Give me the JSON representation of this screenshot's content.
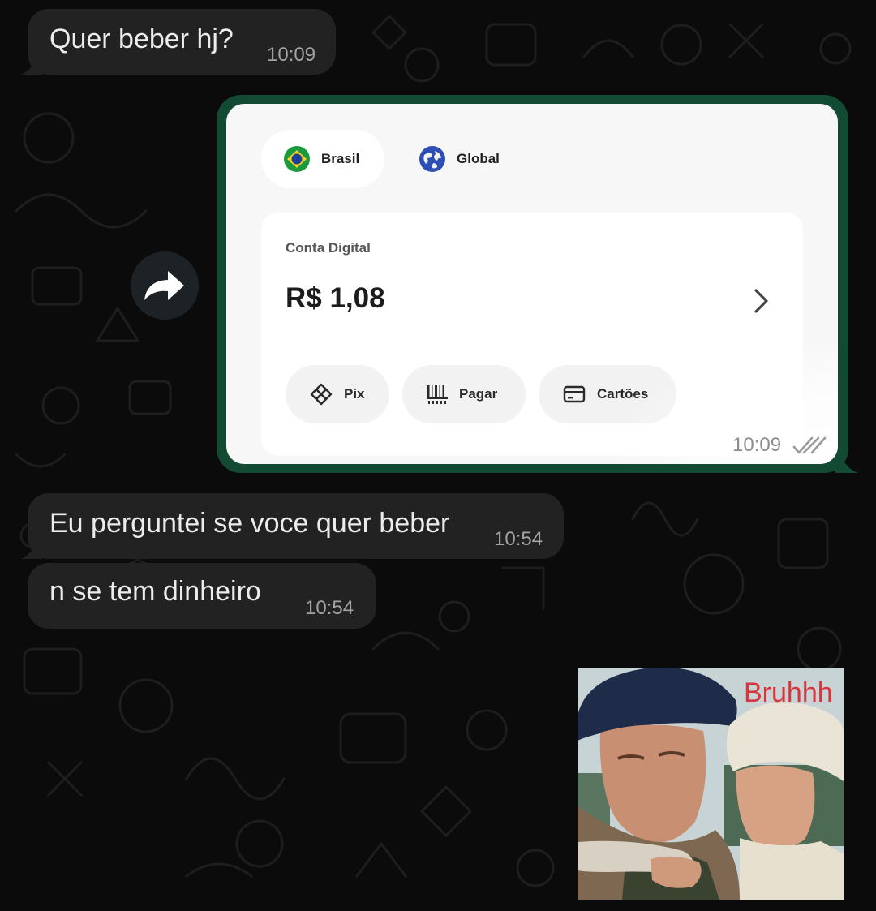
{
  "messages": [
    {
      "text": "Quer beber hj?",
      "time": "10:09"
    },
    {
      "text": "Eu perguntei se voce quer beber",
      "time": "10:54"
    },
    {
      "text": "n se tem dinheiro",
      "time": "10:54"
    }
  ],
  "forwarded_image": {
    "time": "10:09",
    "status_icon": "double-check-icon",
    "screenshot": {
      "tabs": [
        {
          "label": "Brasil",
          "icon": "brazil-flag-icon",
          "active": true
        },
        {
          "label": "Global",
          "icon": "globe-icon",
          "active": false
        }
      ],
      "account_label": "Conta Digital",
      "balance": "R$ 1,08",
      "actions": [
        {
          "label": "Pix",
          "icon": "pix-icon"
        },
        {
          "label": "Pagar",
          "icon": "barcode-icon"
        },
        {
          "label": "Cartões",
          "icon": "card-icon"
        }
      ]
    }
  },
  "forward_button_icon": "forward-arrow-icon",
  "meme": {
    "caption": "Bruhhh"
  },
  "colors": {
    "chat_background": "#0b0b0b",
    "incoming_bubble": "#222222",
    "outgoing_bubble": "#124a34",
    "meme_caption": "#d8353b"
  }
}
